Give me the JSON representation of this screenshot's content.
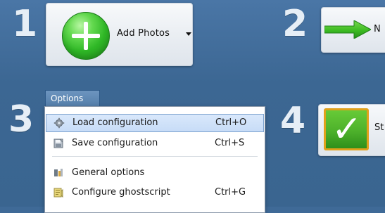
{
  "steps": {
    "step1": "1",
    "step2": "2",
    "step3": "3",
    "step4": "4"
  },
  "toolbar": {
    "add_photos_label": "Add Photos",
    "add_photos_icon": "plus-circle-icon",
    "add_photos_caret": "chevron-down-icon",
    "next_label": "N",
    "next_icon": "right-arrow-icon",
    "start_label": "St",
    "start_icon": "checkmark-icon"
  },
  "menu": {
    "tab_label": "Options",
    "items": [
      {
        "label": "Load configuration",
        "shortcut": "Ctrl+O",
        "icon": "gear-icon",
        "selected": true
      },
      {
        "label": "Save configuration",
        "shortcut": "Ctrl+S",
        "icon": "save-icon",
        "selected": false
      },
      {
        "label": "General options",
        "shortcut": "",
        "icon": "general-options-icon",
        "selected": false
      },
      {
        "label": "Configure ghostscript",
        "shortcut": "Ctrl+G",
        "icon": "ghostscript-icon",
        "selected": false
      }
    ]
  },
  "colors": {
    "background": "#3f6a97",
    "menu_selected": "#c7dcf7",
    "green_accent": "#2fb726",
    "tab_blue": "#547eaa"
  }
}
